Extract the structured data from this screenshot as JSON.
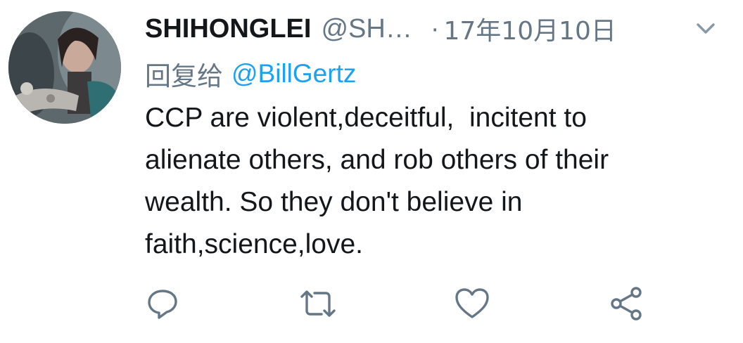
{
  "tweet": {
    "display_name": "SHIHONGLEI",
    "handle": "@SH…",
    "separator": "·",
    "date": "17年10月10日",
    "reply_prefix": "回复给",
    "reply_target": "@BillGertz",
    "text_lines": [
      "CCP are violent,deceitful,  incitent to",
      "alienate others, and rob others of their",
      "wealth. So they don't believe in",
      "faith,science,love."
    ]
  },
  "icons": {
    "caret": "chevron-down-icon",
    "reply": "reply-icon",
    "retweet": "retweet-icon",
    "like": "heart-icon",
    "share": "share-icon"
  },
  "colors": {
    "text": "#14171a",
    "secondary": "#657786",
    "link": "#1da1f2",
    "icon": "#657786"
  }
}
